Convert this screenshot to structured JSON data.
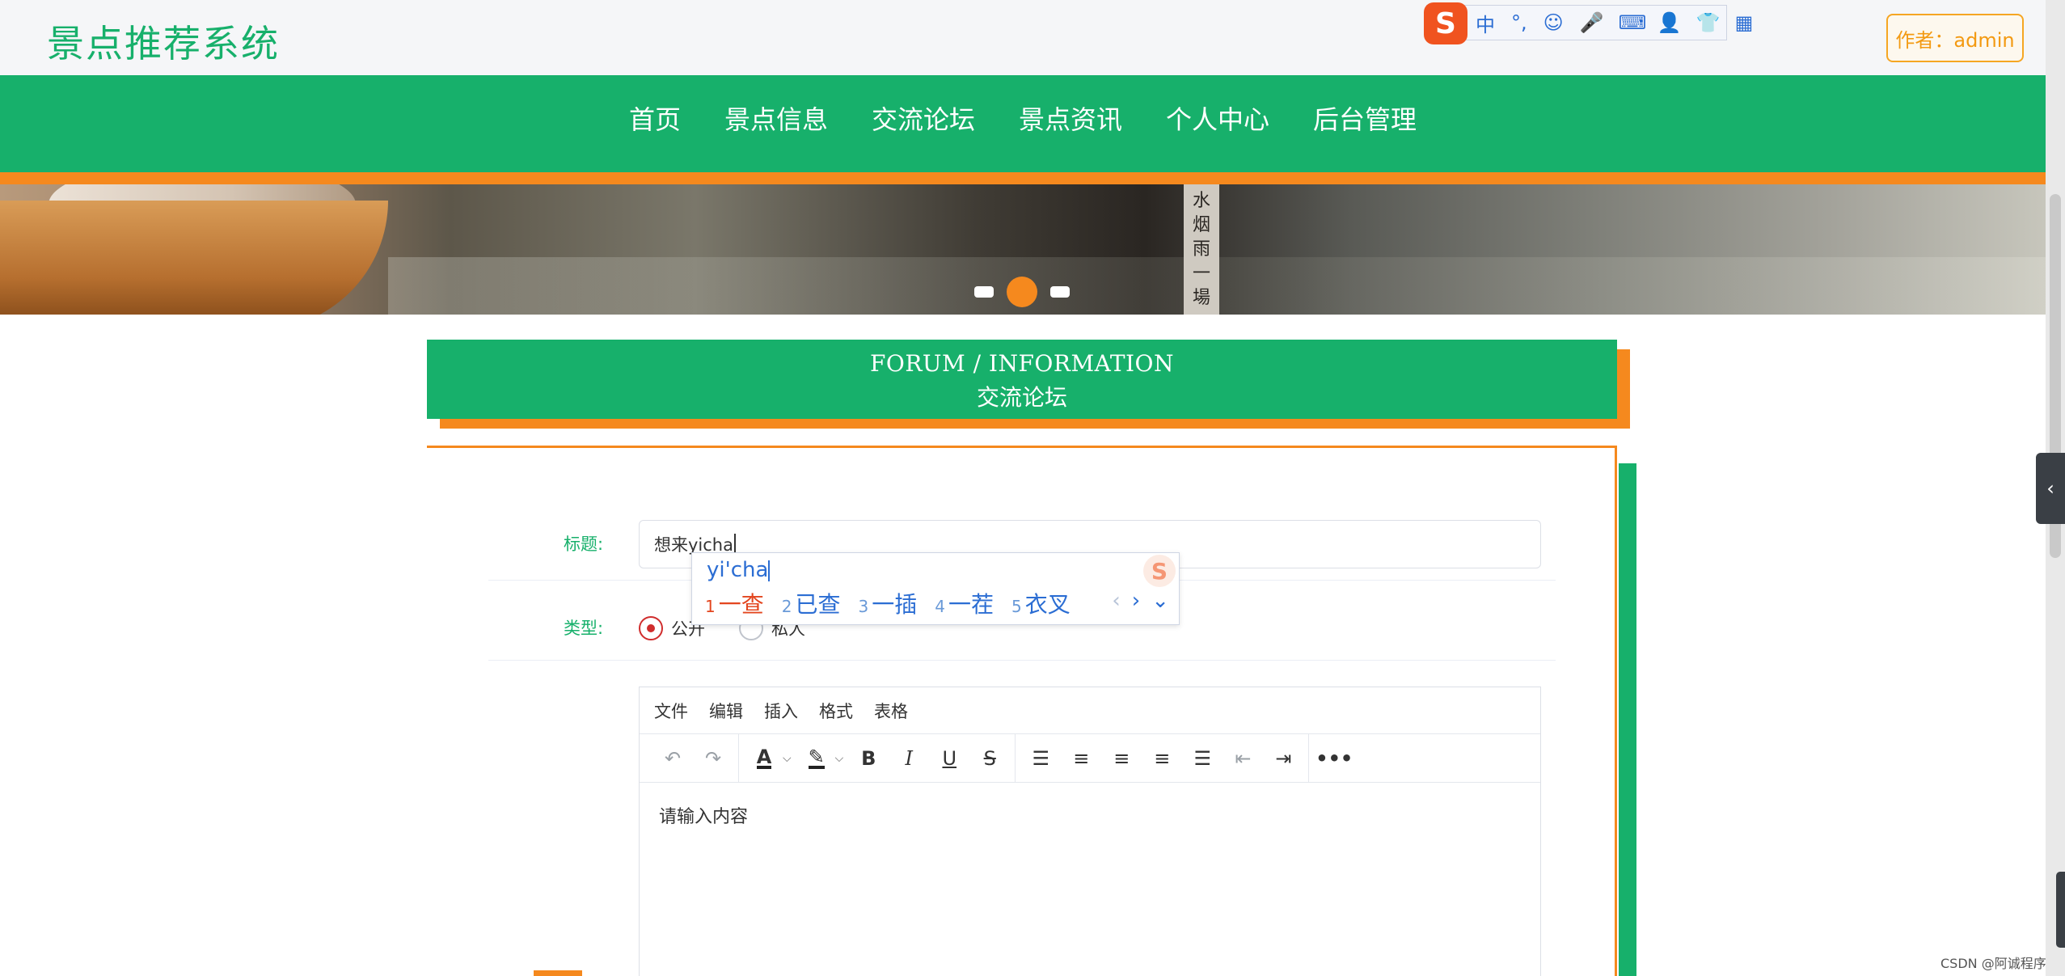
{
  "header": {
    "site_title": "景点推荐系统",
    "author_label": "作者：admin"
  },
  "ime_toolbar": {
    "logo": "S",
    "items": [
      "中",
      "°,",
      "☺",
      "🎤",
      "⌨",
      "👤",
      "👕",
      "▦"
    ]
  },
  "nav": {
    "items": [
      "首页",
      "景点信息",
      "交流论坛",
      "景点资讯",
      "个人中心",
      "后台管理"
    ]
  },
  "banner": {
    "sign_text": [
      "水",
      "烟",
      "雨",
      "一",
      "場",
      "。"
    ],
    "slide_count": 3,
    "active_slide": 2
  },
  "section": {
    "title_en": "FORUM / INFORMATION",
    "title_cn": "交流论坛"
  },
  "form": {
    "title_label": "标题:",
    "title_value": "想来yicha",
    "type_label": "类型:",
    "type_options": [
      {
        "label": "公开",
        "checked": true
      },
      {
        "label": "私人",
        "checked": false
      }
    ]
  },
  "ime_popup": {
    "composition": "yi'cha",
    "candidates": [
      {
        "num": "1",
        "text": "一查"
      },
      {
        "num": "2",
        "text": "已查"
      },
      {
        "num": "3",
        "text": "一插"
      },
      {
        "num": "4",
        "text": "一茬"
      },
      {
        "num": "5",
        "text": "衣叉"
      }
    ],
    "prev": "‹",
    "next": "›",
    "expand": "⌄"
  },
  "editor": {
    "menus": [
      "文件",
      "编辑",
      "插入",
      "格式",
      "表格"
    ],
    "placeholder": "请输入内容"
  },
  "watermark": "CSDN @阿诚程序",
  "colors": {
    "primary_green": "#17b06b",
    "accent_orange": "#f5891e",
    "radio_checked": "#d02d2d",
    "ime_blue": "#2b6dd3"
  }
}
